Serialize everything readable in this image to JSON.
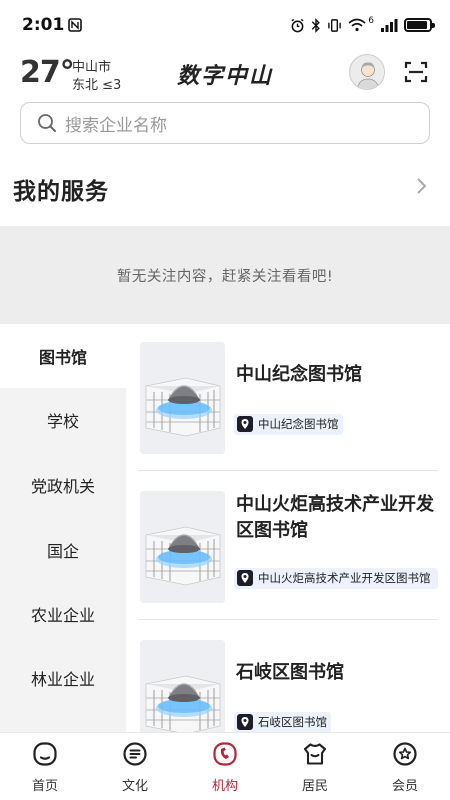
{
  "status_bar": {
    "time": "2:01",
    "network": "6",
    "battery_level": 0.9
  },
  "header": {
    "temperature": "27°",
    "city": "中山市",
    "wind": "东北 ≤3",
    "title": "数字中山"
  },
  "search": {
    "placeholder": "搜索企业名称"
  },
  "services": {
    "title": "我的服务",
    "empty_text": "暂无关注内容，赶紧关注看看吧!"
  },
  "categories": [
    {
      "label": "图书馆",
      "active": true
    },
    {
      "label": "学校",
      "active": false
    },
    {
      "label": "党政机关",
      "active": false
    },
    {
      "label": "国企",
      "active": false
    },
    {
      "label": "农业企业",
      "active": false
    },
    {
      "label": "林业企业",
      "active": false
    }
  ],
  "organizations": [
    {
      "name": "中山纪念图书馆",
      "tag": "中山纪念图书馆"
    },
    {
      "name": "中山火炬高技术产业开发区图书馆",
      "tag": "中山火炬高技术产业开发区图书馆"
    },
    {
      "name": "石岐区图书馆",
      "tag": "石岐区图书馆"
    }
  ],
  "bottom_nav": [
    {
      "label": "首页",
      "icon": "home-icon",
      "active": false
    },
    {
      "label": "文化",
      "icon": "culture-icon",
      "active": false
    },
    {
      "label": "机构",
      "icon": "organization-icon",
      "active": true
    },
    {
      "label": "居民",
      "icon": "resident-icon",
      "active": false
    },
    {
      "label": "会员",
      "icon": "member-icon",
      "active": false
    }
  ],
  "colors": {
    "accent": "#b3263b",
    "tag_bg": "#edf1fb",
    "sidebar_bg": "#f3f3f3",
    "empty_bg": "#ededed"
  }
}
